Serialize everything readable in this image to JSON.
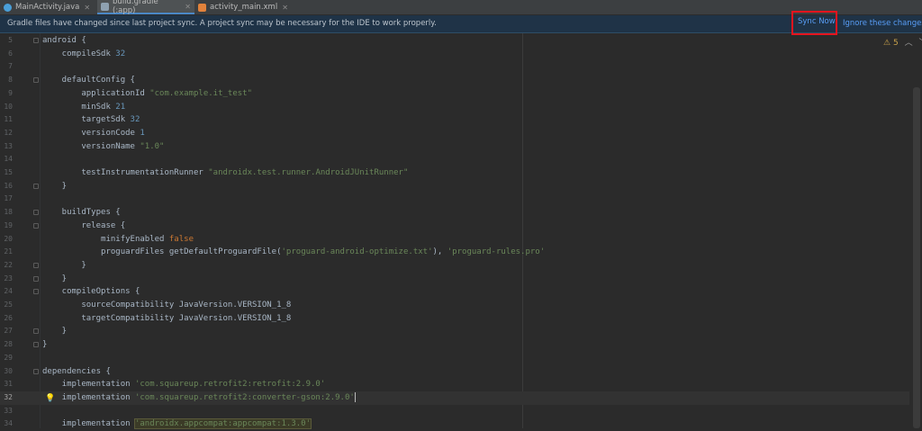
{
  "tabs": [
    {
      "label": "MainActivity.java",
      "icon": "java-class-icon",
      "active": false,
      "icon_color": "#4a9fd8"
    },
    {
      "label": "build.gradle (:app)",
      "icon": "gradle-icon",
      "active": true,
      "icon_color": "#8ea1b1"
    },
    {
      "label": "activity_main.xml",
      "icon": "xml-layout-icon",
      "active": false,
      "icon_color": "#e2823b"
    }
  ],
  "banner": {
    "message": "Gradle files have changed since last project sync. A project sync may be necessary for the IDE to work properly.",
    "sync_now": "Sync Now",
    "ignore": "Ignore these changes"
  },
  "inspection": {
    "warnings": "5"
  },
  "editor": {
    "lines": [
      {
        "n": "5",
        "fold": true,
        "tokens": [
          {
            "t": "android {",
            "c": ""
          }
        ]
      },
      {
        "n": "6",
        "tokens": [
          {
            "t": "    compileSdk ",
            "c": ""
          },
          {
            "t": "32",
            "c": "num"
          }
        ]
      },
      {
        "n": "7",
        "tokens": []
      },
      {
        "n": "8",
        "fold": true,
        "tokens": [
          {
            "t": "    defaultConfig {",
            "c": ""
          }
        ]
      },
      {
        "n": "9",
        "tokens": [
          {
            "t": "        applicationId ",
            "c": ""
          },
          {
            "t": "\"com.example.it_test\"",
            "c": "str"
          }
        ]
      },
      {
        "n": "10",
        "tokens": [
          {
            "t": "        minSdk ",
            "c": ""
          },
          {
            "t": "21",
            "c": "num"
          }
        ]
      },
      {
        "n": "11",
        "tokens": [
          {
            "t": "        targetSdk ",
            "c": ""
          },
          {
            "t": "32",
            "c": "num"
          }
        ]
      },
      {
        "n": "12",
        "tokens": [
          {
            "t": "        versionCode ",
            "c": ""
          },
          {
            "t": "1",
            "c": "num"
          }
        ]
      },
      {
        "n": "13",
        "tokens": [
          {
            "t": "        versionName ",
            "c": ""
          },
          {
            "t": "\"1.0\"",
            "c": "str"
          }
        ]
      },
      {
        "n": "14",
        "tokens": []
      },
      {
        "n": "15",
        "tokens": [
          {
            "t": "        testInstrumentationRunner ",
            "c": ""
          },
          {
            "t": "\"androidx.test.runner.AndroidJUnitRunner\"",
            "c": "str"
          }
        ]
      },
      {
        "n": "16",
        "fold": true,
        "tokens": [
          {
            "t": "    }",
            "c": ""
          }
        ]
      },
      {
        "n": "17",
        "tokens": []
      },
      {
        "n": "18",
        "fold": true,
        "tokens": [
          {
            "t": "    buildTypes {",
            "c": ""
          }
        ]
      },
      {
        "n": "19",
        "fold": true,
        "tokens": [
          {
            "t": "        release {",
            "c": ""
          }
        ]
      },
      {
        "n": "20",
        "tokens": [
          {
            "t": "            minifyEnabled ",
            "c": ""
          },
          {
            "t": "false",
            "c": "kw"
          }
        ]
      },
      {
        "n": "21",
        "tokens": [
          {
            "t": "            proguardFiles getDefaultProguardFile(",
            "c": ""
          },
          {
            "t": "'proguard-android-optimize.txt'",
            "c": "str"
          },
          {
            "t": "), ",
            "c": ""
          },
          {
            "t": "'proguard-rules.pro'",
            "c": "str"
          }
        ]
      },
      {
        "n": "22",
        "fold": true,
        "tokens": [
          {
            "t": "        }",
            "c": ""
          }
        ]
      },
      {
        "n": "23",
        "fold": true,
        "tokens": [
          {
            "t": "    }",
            "c": ""
          }
        ]
      },
      {
        "n": "24",
        "fold": true,
        "tokens": [
          {
            "t": "    compileOptions {",
            "c": ""
          }
        ]
      },
      {
        "n": "25",
        "tokens": [
          {
            "t": "        sourceCompatibility JavaVersion.VERSION_1_8",
            "c": ""
          }
        ]
      },
      {
        "n": "26",
        "tokens": [
          {
            "t": "        targetCompatibility JavaVersion.VERSION_1_8",
            "c": ""
          }
        ]
      },
      {
        "n": "27",
        "fold": true,
        "tokens": [
          {
            "t": "    }",
            "c": ""
          }
        ]
      },
      {
        "n": "28",
        "fold": true,
        "tokens": [
          {
            "t": "}",
            "c": ""
          }
        ]
      },
      {
        "n": "29",
        "tokens": []
      },
      {
        "n": "30",
        "fold": true,
        "tokens": [
          {
            "t": "dependencies {",
            "c": ""
          }
        ]
      },
      {
        "n": "31",
        "tokens": [
          {
            "t": "    implementation ",
            "c": ""
          },
          {
            "t": "'com.squareup.retrofit2:retrofit:2.9.0'",
            "c": "str"
          }
        ]
      },
      {
        "n": "32",
        "current": true,
        "bulb": true,
        "tokens": [
          {
            "t": "    implementation ",
            "c": ""
          },
          {
            "t": "'com.squareup.retrofit2:converter-gson:2.9.0'",
            "c": "str"
          }
        ]
      },
      {
        "n": "33",
        "tokens": []
      },
      {
        "n": "34",
        "tokens": [
          {
            "t": "    implementation ",
            "c": ""
          },
          {
            "t": "'androidx.appcompat:appcompat:1.3.0'",
            "c": "str hl"
          }
        ]
      }
    ]
  }
}
